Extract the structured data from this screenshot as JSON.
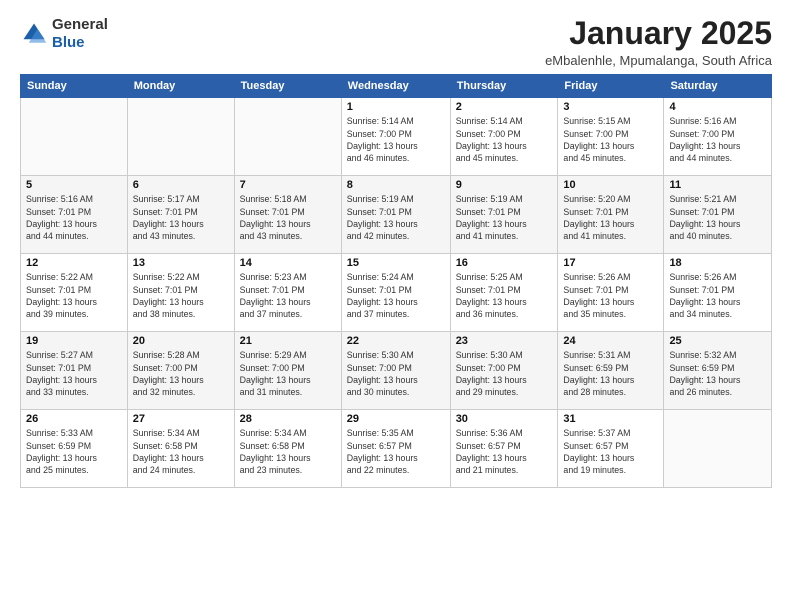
{
  "logo": {
    "general": "General",
    "blue": "Blue"
  },
  "title": "January 2025",
  "subtitle": "eMbalenhle, Mpumalanga, South Africa",
  "days_of_week": [
    "Sunday",
    "Monday",
    "Tuesday",
    "Wednesday",
    "Thursday",
    "Friday",
    "Saturday"
  ],
  "weeks": [
    [
      {
        "day": "",
        "info": ""
      },
      {
        "day": "",
        "info": ""
      },
      {
        "day": "",
        "info": ""
      },
      {
        "day": "1",
        "info": "Sunrise: 5:14 AM\nSunset: 7:00 PM\nDaylight: 13 hours\nand 46 minutes."
      },
      {
        "day": "2",
        "info": "Sunrise: 5:14 AM\nSunset: 7:00 PM\nDaylight: 13 hours\nand 45 minutes."
      },
      {
        "day": "3",
        "info": "Sunrise: 5:15 AM\nSunset: 7:00 PM\nDaylight: 13 hours\nand 45 minutes."
      },
      {
        "day": "4",
        "info": "Sunrise: 5:16 AM\nSunset: 7:00 PM\nDaylight: 13 hours\nand 44 minutes."
      }
    ],
    [
      {
        "day": "5",
        "info": "Sunrise: 5:16 AM\nSunset: 7:01 PM\nDaylight: 13 hours\nand 44 minutes."
      },
      {
        "day": "6",
        "info": "Sunrise: 5:17 AM\nSunset: 7:01 PM\nDaylight: 13 hours\nand 43 minutes."
      },
      {
        "day": "7",
        "info": "Sunrise: 5:18 AM\nSunset: 7:01 PM\nDaylight: 13 hours\nand 43 minutes."
      },
      {
        "day": "8",
        "info": "Sunrise: 5:19 AM\nSunset: 7:01 PM\nDaylight: 13 hours\nand 42 minutes."
      },
      {
        "day": "9",
        "info": "Sunrise: 5:19 AM\nSunset: 7:01 PM\nDaylight: 13 hours\nand 41 minutes."
      },
      {
        "day": "10",
        "info": "Sunrise: 5:20 AM\nSunset: 7:01 PM\nDaylight: 13 hours\nand 41 minutes."
      },
      {
        "day": "11",
        "info": "Sunrise: 5:21 AM\nSunset: 7:01 PM\nDaylight: 13 hours\nand 40 minutes."
      }
    ],
    [
      {
        "day": "12",
        "info": "Sunrise: 5:22 AM\nSunset: 7:01 PM\nDaylight: 13 hours\nand 39 minutes."
      },
      {
        "day": "13",
        "info": "Sunrise: 5:22 AM\nSunset: 7:01 PM\nDaylight: 13 hours\nand 38 minutes."
      },
      {
        "day": "14",
        "info": "Sunrise: 5:23 AM\nSunset: 7:01 PM\nDaylight: 13 hours\nand 37 minutes."
      },
      {
        "day": "15",
        "info": "Sunrise: 5:24 AM\nSunset: 7:01 PM\nDaylight: 13 hours\nand 37 minutes."
      },
      {
        "day": "16",
        "info": "Sunrise: 5:25 AM\nSunset: 7:01 PM\nDaylight: 13 hours\nand 36 minutes."
      },
      {
        "day": "17",
        "info": "Sunrise: 5:26 AM\nSunset: 7:01 PM\nDaylight: 13 hours\nand 35 minutes."
      },
      {
        "day": "18",
        "info": "Sunrise: 5:26 AM\nSunset: 7:01 PM\nDaylight: 13 hours\nand 34 minutes."
      }
    ],
    [
      {
        "day": "19",
        "info": "Sunrise: 5:27 AM\nSunset: 7:01 PM\nDaylight: 13 hours\nand 33 minutes."
      },
      {
        "day": "20",
        "info": "Sunrise: 5:28 AM\nSunset: 7:00 PM\nDaylight: 13 hours\nand 32 minutes."
      },
      {
        "day": "21",
        "info": "Sunrise: 5:29 AM\nSunset: 7:00 PM\nDaylight: 13 hours\nand 31 minutes."
      },
      {
        "day": "22",
        "info": "Sunrise: 5:30 AM\nSunset: 7:00 PM\nDaylight: 13 hours\nand 30 minutes."
      },
      {
        "day": "23",
        "info": "Sunrise: 5:30 AM\nSunset: 7:00 PM\nDaylight: 13 hours\nand 29 minutes."
      },
      {
        "day": "24",
        "info": "Sunrise: 5:31 AM\nSunset: 6:59 PM\nDaylight: 13 hours\nand 28 minutes."
      },
      {
        "day": "25",
        "info": "Sunrise: 5:32 AM\nSunset: 6:59 PM\nDaylight: 13 hours\nand 26 minutes."
      }
    ],
    [
      {
        "day": "26",
        "info": "Sunrise: 5:33 AM\nSunset: 6:59 PM\nDaylight: 13 hours\nand 25 minutes."
      },
      {
        "day": "27",
        "info": "Sunrise: 5:34 AM\nSunset: 6:58 PM\nDaylight: 13 hours\nand 24 minutes."
      },
      {
        "day": "28",
        "info": "Sunrise: 5:34 AM\nSunset: 6:58 PM\nDaylight: 13 hours\nand 23 minutes."
      },
      {
        "day": "29",
        "info": "Sunrise: 5:35 AM\nSunset: 6:57 PM\nDaylight: 13 hours\nand 22 minutes."
      },
      {
        "day": "30",
        "info": "Sunrise: 5:36 AM\nSunset: 6:57 PM\nDaylight: 13 hours\nand 21 minutes."
      },
      {
        "day": "31",
        "info": "Sunrise: 5:37 AM\nSunset: 6:57 PM\nDaylight: 13 hours\nand 19 minutes."
      },
      {
        "day": "",
        "info": ""
      }
    ]
  ]
}
